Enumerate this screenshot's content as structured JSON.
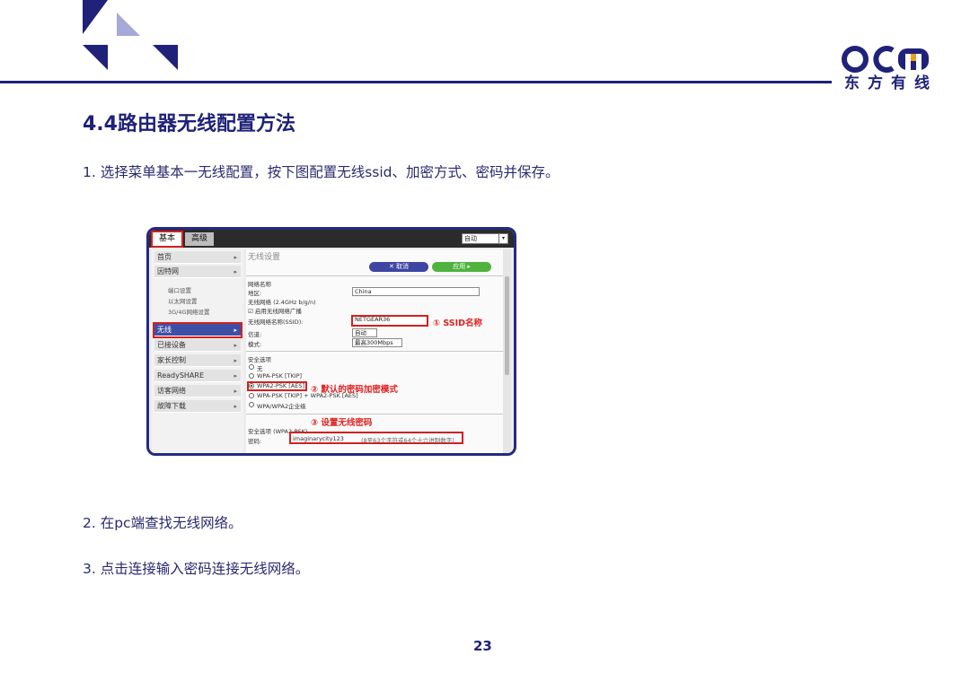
{
  "header": {
    "logo_text": "OCN",
    "logo_cn": "东方有线",
    "brand_color": "#1f2278",
    "accent_color": "#a7a9d6"
  },
  "title": "4.4路由器无线配置方法",
  "steps": [
    "1. 选择菜单基本一无线配置，按下图配置无线ssid、加密方式、密码并保存。",
    "2. 在pc端查找无线网络。",
    "3. 点击连接输入密码连接无线网络。"
  ],
  "page_number": "23",
  "screenshot": {
    "tabs": {
      "basic": "基本",
      "advanced": "高级"
    },
    "language_select": "自动",
    "nav": [
      {
        "label": "首页"
      },
      {
        "label": "因特网"
      },
      {
        "label": "无线"
      },
      {
        "label": "已接设备"
      },
      {
        "label": "家长控制"
      },
      {
        "label": "ReadySHARE"
      },
      {
        "label": "访客网络"
      },
      {
        "label": "故障下载"
      }
    ],
    "nav_sub": [
      "端口设置",
      "以太网设置",
      "3G/4G网络设置"
    ],
    "main_title": "无线设置",
    "buttons": {
      "cancel": "✕ 取消",
      "apply": "应用 ▸"
    },
    "network": {
      "section": "网络名称",
      "region_label": "地区:",
      "region_value": "China",
      "band_label": "无线网络 (2.4GHz b/g/n)",
      "broadcast_label": "启用无线网络广播",
      "ssid_label": "无线网络名称(SSID):",
      "ssid_value": "NETGEAR36",
      "channel_label": "信道:",
      "channel_value": "自动",
      "mode_label": "模式:",
      "mode_value": "最高300Mbps"
    },
    "security": {
      "section": "安全选项",
      "options": [
        "无",
        "WPA-PSK [TKIP]",
        "WPA2-PSK [AES]",
        "WPA-PSK [TKIP] + WPA2-PSK [AES]",
        "WPA/WPA2企业级"
      ],
      "selected_index": 2,
      "key_section": "安全选项 (WPA2-PSK)",
      "password_label": "密码:",
      "password_value": "imaginarycity123",
      "password_hint": "(8至63个字符或64个十六进制数字)"
    },
    "annotations": {
      "ssid": "① SSID名称",
      "encryption": "② 默认的密码加密模式",
      "password": "③ 设置无线密码"
    }
  }
}
